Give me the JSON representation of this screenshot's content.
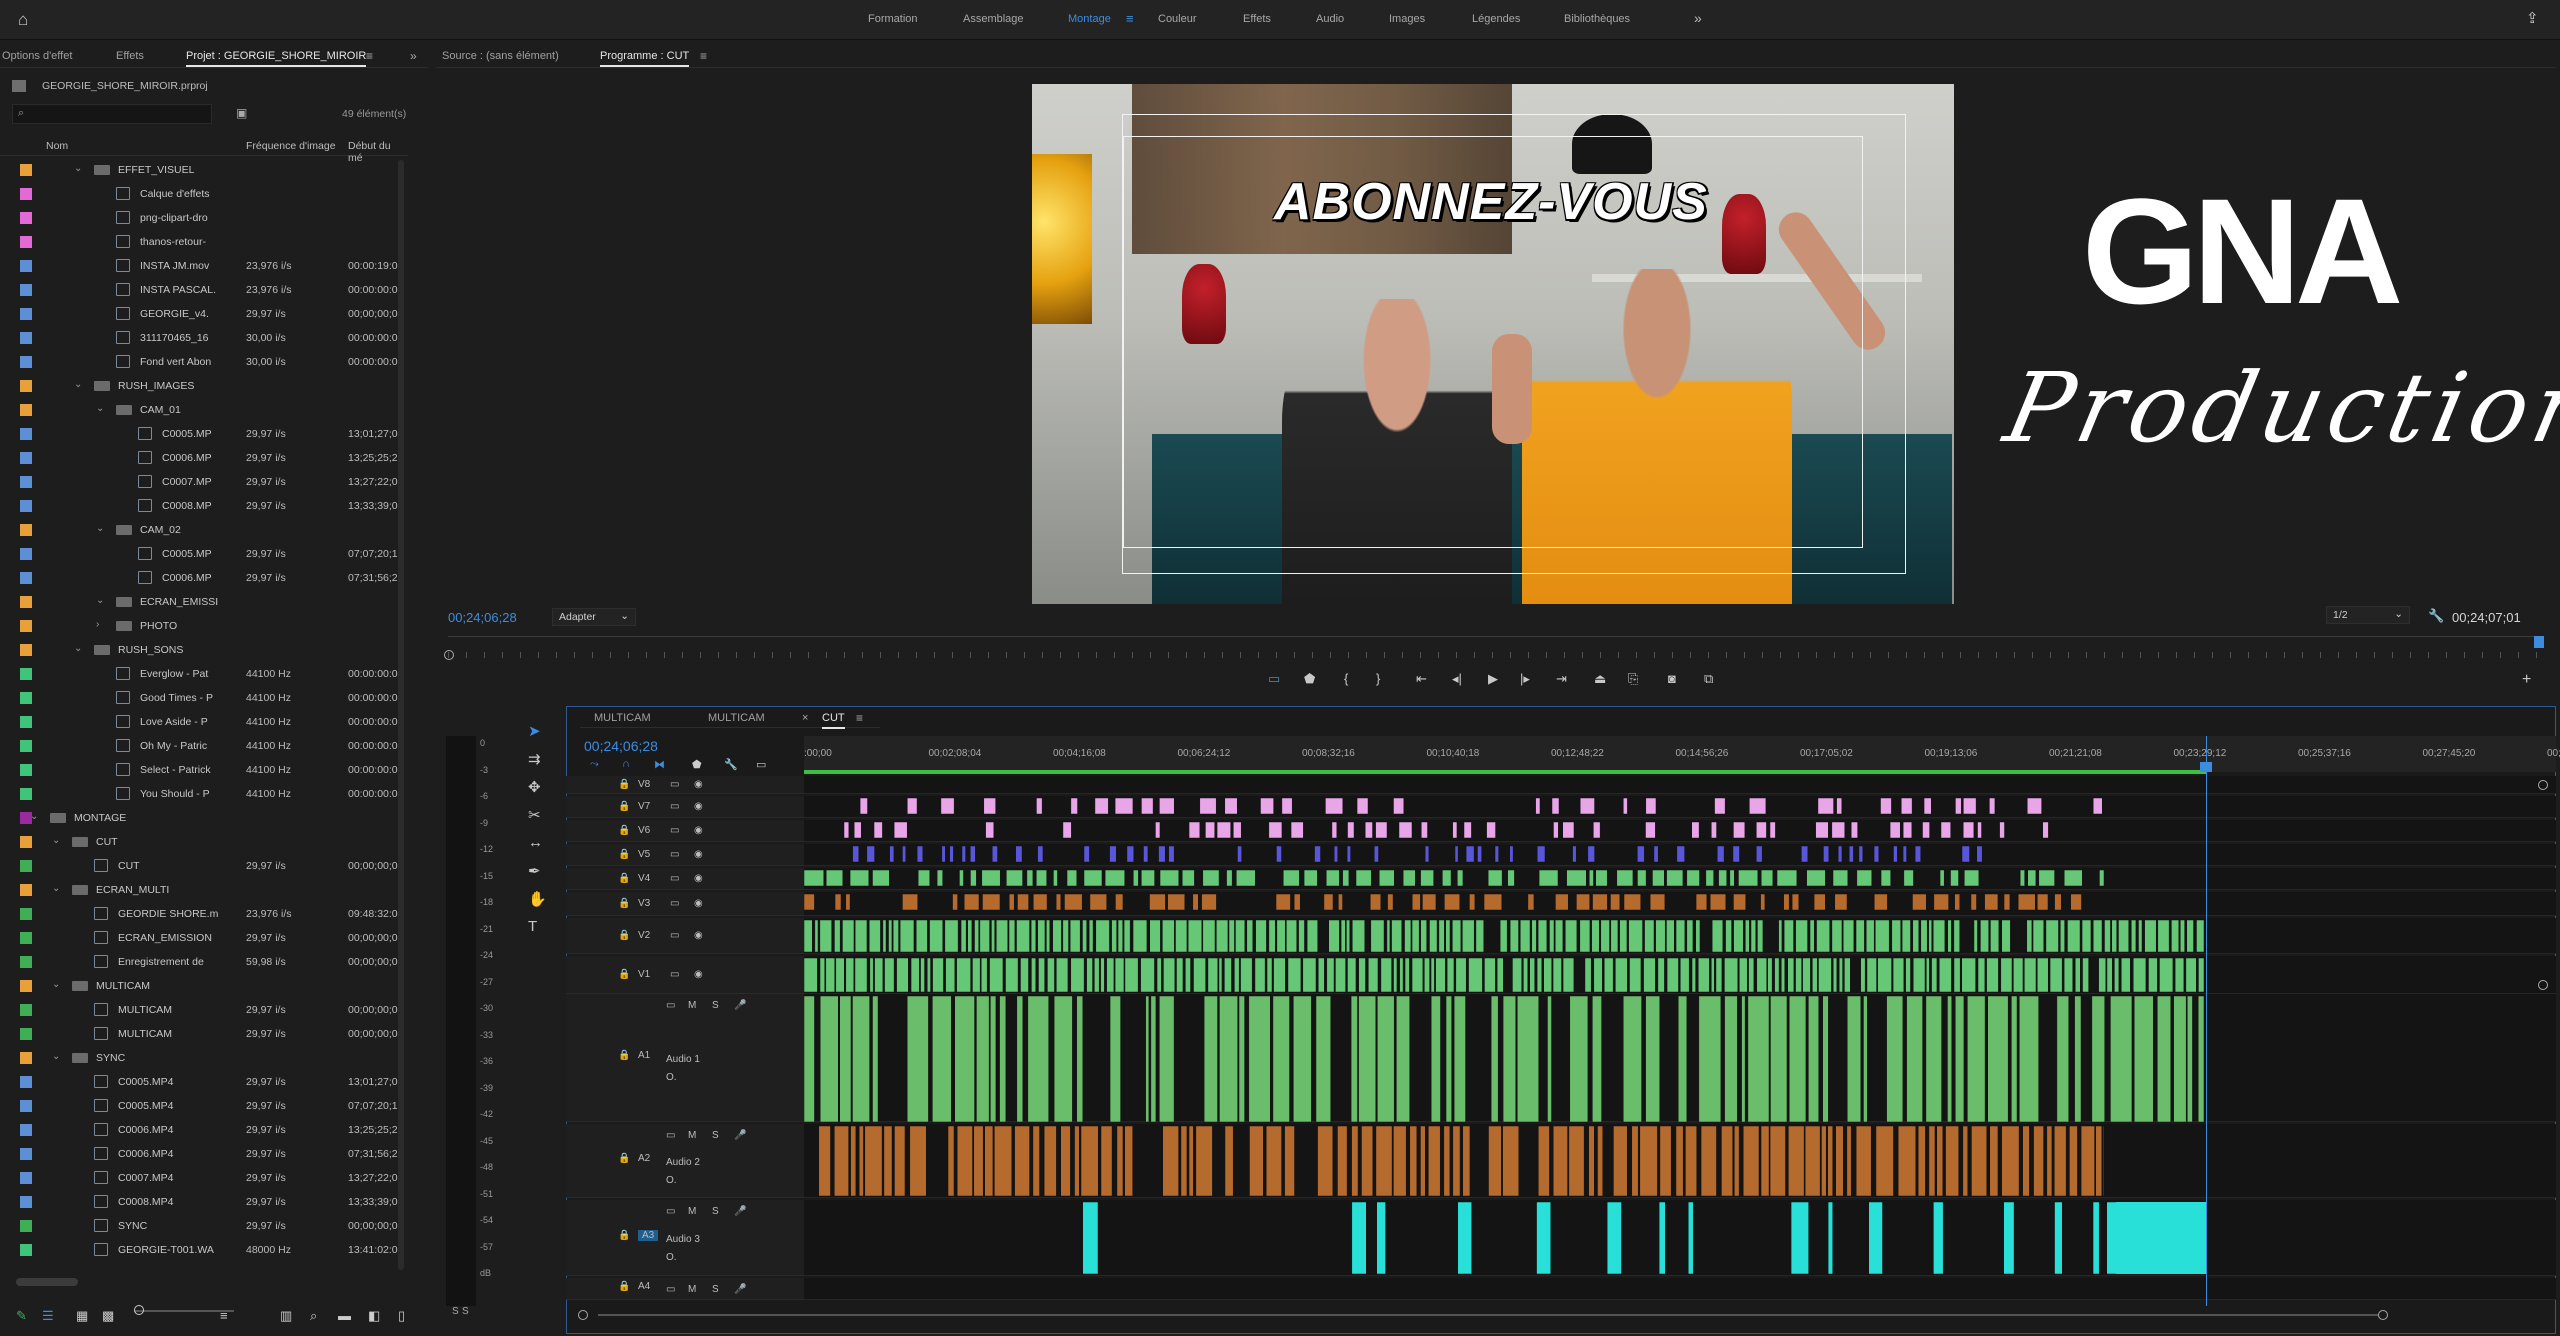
{
  "workspace": {
    "items": [
      "Formation",
      "Assemblage",
      "Montage",
      "Couleur",
      "Effets",
      "Audio",
      "Images",
      "Légendes",
      "Bibliothèques"
    ],
    "active": "Montage"
  },
  "left_tabs": [
    "Options d'effet",
    "Effets",
    "Projet : GEORGIE_SHORE_MIROIR"
  ],
  "project": {
    "file": "GEORGIE_SHORE_MIROIR.prproj",
    "count": "49 élément(s)",
    "col_name": "Nom",
    "col_fps": "Fréquence d'image",
    "col_start": "Début du mé",
    "rows": [
      {
        "indent": 2,
        "type": "folder",
        "name": "EFFET_VISUEL",
        "fps": "",
        "start": "",
        "color": "#e8a03a"
      },
      {
        "indent": 3,
        "type": "file",
        "name": "Calque d'effets",
        "fps": "",
        "start": "",
        "color": "#e36ad6"
      },
      {
        "indent": 3,
        "type": "file",
        "name": "png-clipart-dro",
        "fps": "",
        "start": "",
        "color": "#e36ad6"
      },
      {
        "indent": 3,
        "type": "file",
        "name": "thanos-retour-",
        "fps": "",
        "start": "",
        "color": "#e36ad6"
      },
      {
        "indent": 3,
        "type": "file",
        "name": "INSTA JM.mov",
        "fps": "23,976 i/s",
        "start": "00:00:19:0",
        "color": "#5d8fd4"
      },
      {
        "indent": 3,
        "type": "file",
        "name": "INSTA PASCAL.",
        "fps": "23,976 i/s",
        "start": "00:00:00:0",
        "color": "#5d8fd4"
      },
      {
        "indent": 3,
        "type": "file",
        "name": "GEORGIE_v4.",
        "fps": "29,97 i/s",
        "start": "00;00;00;0",
        "color": "#5d8fd4"
      },
      {
        "indent": 3,
        "type": "file",
        "name": "311170465_16",
        "fps": "30,00 i/s",
        "start": "00:00:00:0",
        "color": "#5d8fd4"
      },
      {
        "indent": 3,
        "type": "file",
        "name": "Fond vert Abon",
        "fps": "30,00 i/s",
        "start": "00:00:00:0",
        "color": "#5d8fd4"
      },
      {
        "indent": 2,
        "type": "folder",
        "name": "RUSH_IMAGES",
        "fps": "",
        "start": "",
        "color": "#e8a03a"
      },
      {
        "indent": 3,
        "type": "folder",
        "name": "CAM_01",
        "fps": "",
        "start": "",
        "color": "#e8a03a"
      },
      {
        "indent": 4,
        "type": "file",
        "name": "C0005.MP",
        "fps": "29,97 i/s",
        "start": "13;01;27;0",
        "color": "#5d8fd4"
      },
      {
        "indent": 4,
        "type": "file",
        "name": "C0006.MP",
        "fps": "29,97 i/s",
        "start": "13;25;25;2",
        "color": "#5d8fd4"
      },
      {
        "indent": 4,
        "type": "file",
        "name": "C0007.MP",
        "fps": "29,97 i/s",
        "start": "13;27;22;0",
        "color": "#5d8fd4"
      },
      {
        "indent": 4,
        "type": "file",
        "name": "C0008.MP",
        "fps": "29,97 i/s",
        "start": "13;33;39;0",
        "color": "#5d8fd4"
      },
      {
        "indent": 3,
        "type": "folder",
        "name": "CAM_02",
        "fps": "",
        "start": "",
        "color": "#e8a03a"
      },
      {
        "indent": 4,
        "type": "file",
        "name": "C0005.MP",
        "fps": "29,97 i/s",
        "start": "07;07;20;1",
        "color": "#5d8fd4"
      },
      {
        "indent": 4,
        "type": "file",
        "name": "C0006.MP",
        "fps": "29,97 i/s",
        "start": "07;31;56;2",
        "color": "#5d8fd4"
      },
      {
        "indent": 3,
        "type": "folder",
        "name": "ECRAN_EMISSI",
        "fps": "",
        "start": "",
        "color": "#e8a03a"
      },
      {
        "indent": 3,
        "type": "folder",
        "name": "PHOTO",
        "fps": "",
        "start": "",
        "color": "#e8a03a"
      },
      {
        "indent": 2,
        "type": "folder",
        "name": "RUSH_SONS",
        "fps": "",
        "start": "",
        "color": "#e8a03a"
      },
      {
        "indent": 3,
        "type": "file",
        "name": "Everglow - Pat",
        "fps": "44100  Hz",
        "start": "00:00:00:0",
        "color": "#3fc47a"
      },
      {
        "indent": 3,
        "type": "file",
        "name": "Good Times - P",
        "fps": "44100  Hz",
        "start": "00:00:00:0",
        "color": "#3fc47a"
      },
      {
        "indent": 3,
        "type": "file",
        "name": "Love Aside - P",
        "fps": "44100  Hz",
        "start": "00:00:00:0",
        "color": "#3fc47a"
      },
      {
        "indent": 3,
        "type": "file",
        "name": "Oh My - Patric",
        "fps": "44100  Hz",
        "start": "00:00:00:0",
        "color": "#3fc47a"
      },
      {
        "indent": 3,
        "type": "file",
        "name": "Select - Patrick",
        "fps": "44100  Hz",
        "start": "00:00:00:0",
        "color": "#3fc47a"
      },
      {
        "indent": 3,
        "type": "file",
        "name": "You Should - P",
        "fps": "44100  Hz",
        "start": "00:00:00:0",
        "color": "#3fc47a"
      },
      {
        "indent": 0,
        "type": "folder",
        "name": "MONTAGE",
        "fps": "",
        "start": "",
        "color": "#9b2aa0"
      },
      {
        "indent": 1,
        "type": "folder",
        "name": "CUT",
        "fps": "",
        "start": "",
        "color": "#e8a03a"
      },
      {
        "indent": 2,
        "type": "seq",
        "name": "CUT",
        "fps": "29,97 i/s",
        "start": "00;00;00;0",
        "color": "#3fae57"
      },
      {
        "indent": 1,
        "type": "folder",
        "name": "ECRAN_MULTI",
        "fps": "",
        "start": "",
        "color": "#e8a03a"
      },
      {
        "indent": 2,
        "type": "seq",
        "name": "GEORDIE SHORE.m",
        "fps": "23,976 i/s",
        "start": "09:48:32:0",
        "color": "#3fae57"
      },
      {
        "indent": 2,
        "type": "seq",
        "name": "ECRAN_EMISSION",
        "fps": "29,97 i/s",
        "start": "00;00;00;0",
        "color": "#3fae57"
      },
      {
        "indent": 2,
        "type": "seq",
        "name": "Enregistrement de",
        "fps": "59,98 i/s",
        "start": "00;00;00;0",
        "color": "#3fae57"
      },
      {
        "indent": 1,
        "type": "folder",
        "name": "MULTICAM",
        "fps": "",
        "start": "",
        "color": "#e8a03a"
      },
      {
        "indent": 2,
        "type": "seq",
        "name": "MULTICAM",
        "fps": "29,97 i/s",
        "start": "00;00;00;0",
        "color": "#3fae57"
      },
      {
        "indent": 2,
        "type": "seq",
        "name": "MULTICAM",
        "fps": "29,97 i/s",
        "start": "00;00;00;0",
        "color": "#3fae57"
      },
      {
        "indent": 1,
        "type": "folder",
        "name": "SYNC",
        "fps": "",
        "start": "",
        "color": "#e8a03a"
      },
      {
        "indent": 2,
        "type": "file",
        "name": "C0005.MP4",
        "fps": "29,97 i/s",
        "start": "13;01;27;0",
        "color": "#5d8fd4"
      },
      {
        "indent": 2,
        "type": "file",
        "name": "C0005.MP4",
        "fps": "29,97 i/s",
        "start": "07;07;20;1",
        "color": "#5d8fd4"
      },
      {
        "indent": 2,
        "type": "file",
        "name": "C0006.MP4",
        "fps": "29,97 i/s",
        "start": "13;25;25;2",
        "color": "#5d8fd4"
      },
      {
        "indent": 2,
        "type": "file",
        "name": "C0006.MP4",
        "fps": "29,97 i/s",
        "start": "07;31;56;2",
        "color": "#5d8fd4"
      },
      {
        "indent": 2,
        "type": "file",
        "name": "C0007.MP4",
        "fps": "29,97 i/s",
        "start": "13;27;22;0",
        "color": "#5d8fd4"
      },
      {
        "indent": 2,
        "type": "file",
        "name": "C0008.MP4",
        "fps": "29,97 i/s",
        "start": "13;33;39;0",
        "color": "#5d8fd4"
      },
      {
        "indent": 2,
        "type": "seq",
        "name": "SYNC",
        "fps": "29,97 i/s",
        "start": "00;00;00;0",
        "color": "#3fae57"
      },
      {
        "indent": 2,
        "type": "file",
        "name": "GEORGIE-T001.WA",
        "fps": "48000  Hz",
        "start": "13:41:02:0",
        "color": "#3fc47a"
      }
    ]
  },
  "monitor": {
    "source_tab": "Source : (sans élément)",
    "program_tab": "Programme : CUT",
    "timecode": "00;24;06;28",
    "fit": "Adapter",
    "quality": "1/2",
    "duration": "00;24;07;01",
    "overlay_text": "ABONNEZ-VOUS",
    "logo_main": "GNA",
    "logo_script": "Production"
  },
  "timeline": {
    "tabs": [
      "MULTICAM",
      "MULTICAM",
      "CUT"
    ],
    "timecode": "00;24;06;28",
    "ticks": [
      ":00;00",
      "00;02;08;04",
      "00;04;16;08",
      "00;06;24;12",
      "00;08;32;16",
      "00;10;40;18",
      "00;12;48;22",
      "00;14;56;26",
      "00;17;05;02",
      "00;19;13;06",
      "00;21;21;08",
      "00;23;29;12",
      "00;25;37;16",
      "00;27;45;20",
      "00;"
    ],
    "video_tracks": [
      "V8",
      "V7",
      "V6",
      "V5",
      "V4",
      "V3",
      "V2",
      "V1"
    ],
    "audio_tracks": [
      {
        "id": "A1",
        "name": "Audio 1"
      },
      {
        "id": "A2",
        "name": "Audio 2"
      },
      {
        "id": "A3",
        "name": "Audio 3"
      },
      {
        "id": "A4",
        "name": ""
      }
    ],
    "meter_ticks": [
      "0",
      "-3",
      "-6",
      "-9",
      "-12",
      "-15",
      "-18",
      "-21",
      "-24",
      "-27",
      "-30",
      "-33",
      "-36",
      "-39",
      "-42",
      "-45",
      "-48",
      "-51",
      "-54",
      "-57",
      "dB"
    ]
  },
  "colors": {
    "accent": "#3d8ce0",
    "video_pink": "#e8a6e9",
    "video_blue": "#5a56d8",
    "video_green": "#66c777",
    "audio_green": "#6abd6a",
    "audio_orange": "#b56a2e",
    "audio_cyan": "#29e0d8"
  }
}
